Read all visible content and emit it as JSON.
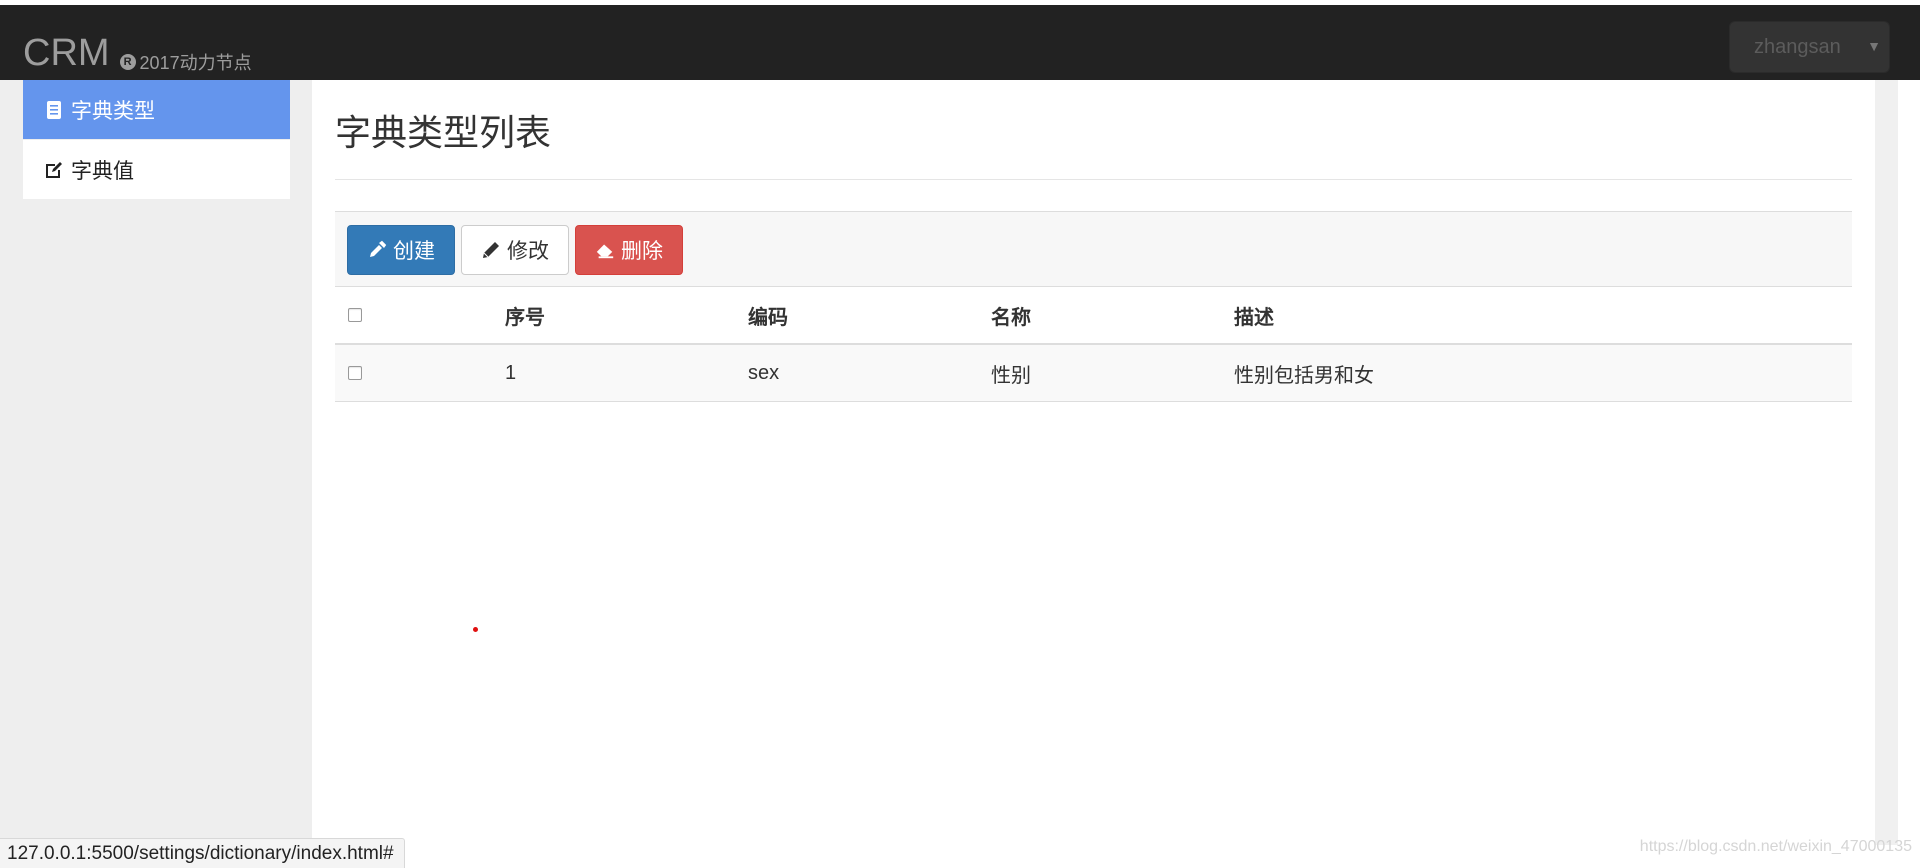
{
  "navbar": {
    "brand": "CRM",
    "reg_symbol": "R",
    "subtitle": "2017动力节点",
    "user": "zhangsan",
    "caret": "▼"
  },
  "sidebar": {
    "items": [
      {
        "label": "字典类型",
        "icon": "book-icon",
        "active": true
      },
      {
        "label": "字典值",
        "icon": "edit-icon",
        "active": false
      }
    ]
  },
  "main": {
    "title": "字典类型列表",
    "toolbar": {
      "create": "创建",
      "edit": "修改",
      "delete": "删除"
    },
    "table": {
      "columns": [
        "序号",
        "编码",
        "名称",
        "描述"
      ],
      "rows": [
        {
          "index": "1",
          "code": "sex",
          "name": "性别",
          "description": "性别包括男和女"
        }
      ]
    }
  },
  "statusbar": {
    "url": "127.0.0.1:5500/settings/dictionary/index.html#"
  },
  "watermark": "https://blog.csdn.net/weixin_47000135",
  "colors": {
    "navbar": "#222222",
    "sidebar_active": "#6495ed",
    "primary": "#337ab7",
    "danger": "#d9534f"
  }
}
